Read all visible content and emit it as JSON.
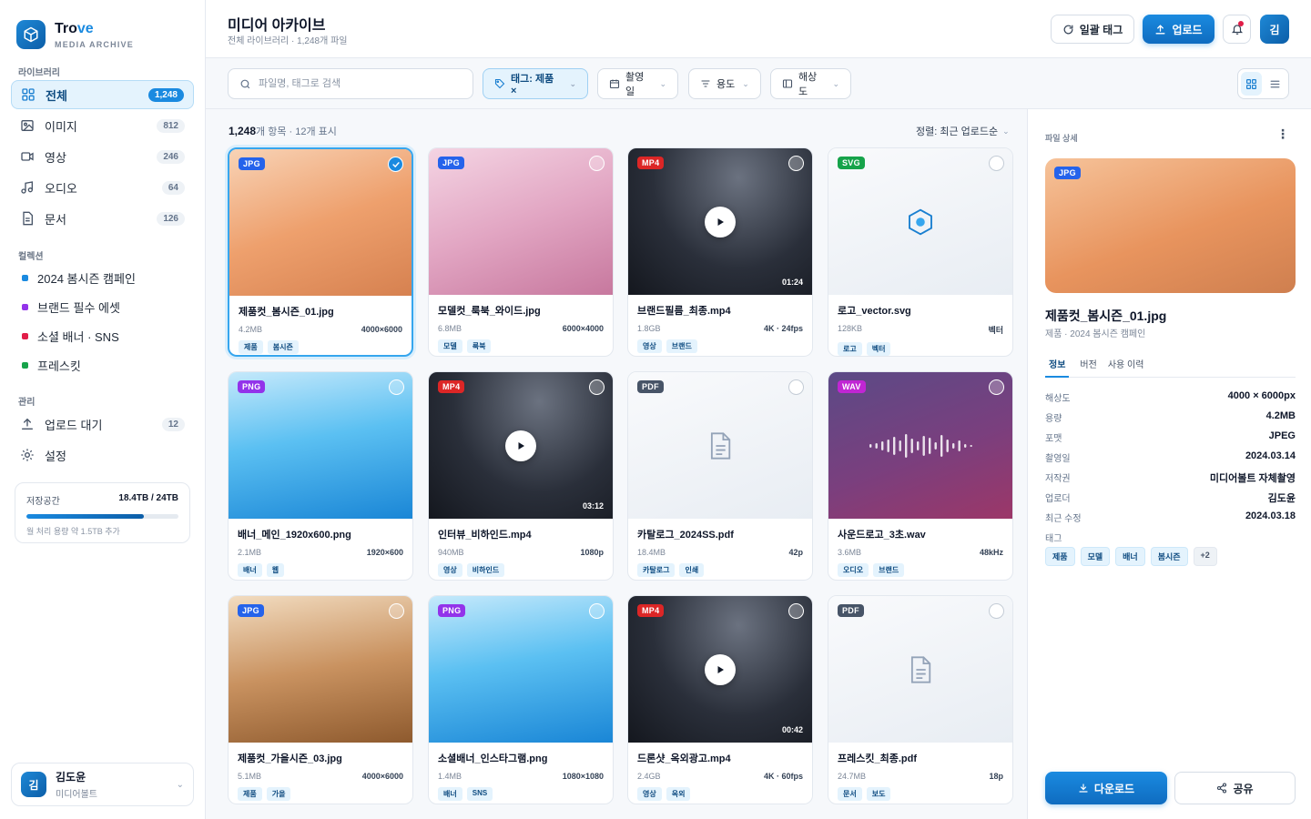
{
  "brand": {
    "name_main": "Tro",
    "name_accent": "ve",
    "subtitle": "MEDIA ARCHIVE"
  },
  "sidebar": {
    "library_label": "라이브러리",
    "library": [
      {
        "label": "전체",
        "count": "1,248",
        "icon": "grid-icon",
        "active": true
      },
      {
        "label": "이미지",
        "count": "812",
        "icon": "image-icon"
      },
      {
        "label": "영상",
        "count": "246",
        "icon": "video-icon"
      },
      {
        "label": "오디오",
        "count": "64",
        "icon": "music-icon"
      },
      {
        "label": "문서",
        "count": "126",
        "icon": "document-icon"
      }
    ],
    "collections_label": "컬렉션",
    "collections": [
      {
        "label": "2024 봄시즌 캠페인",
        "color": "#1a8ae0"
      },
      {
        "label": "브랜드 필수 에셋",
        "color": "#9333ea"
      },
      {
        "label": "소셜 배너 · SNS",
        "color": "#e11d48"
      },
      {
        "label": "프레스킷",
        "color": "#16a34a"
      }
    ],
    "manage_label": "관리",
    "manage": [
      {
        "label": "업로드 대기",
        "count": "12",
        "icon": "upload-icon"
      },
      {
        "label": "설정",
        "icon": "settings-icon"
      }
    ],
    "storage": {
      "label": "저장공간",
      "value": "18.4TB / 24TB",
      "fraction": 0.77,
      "note": "월 처리 용량 약 1.5TB 추가"
    },
    "user": {
      "initial": "김",
      "name": "김도윤",
      "org": "미디어볼트"
    }
  },
  "header": {
    "title": "미디어 아카이브",
    "subtitle": "전체 라이브러리 · 1,248개 파일",
    "bulk_tag": "일괄 태그",
    "upload": "업로드",
    "avatar": "김"
  },
  "toolbar": {
    "search_placeholder": "파일명, 태그로 검색",
    "filters": [
      {
        "label": "태그: 제품 ×",
        "active": true,
        "icon": "tag-icon"
      },
      {
        "label": "촬영일",
        "icon": "calendar-icon"
      },
      {
        "label": "용도",
        "icon": "filter-icon"
      },
      {
        "label": "해상도",
        "icon": "resolution-icon"
      }
    ]
  },
  "listing": {
    "count": "1,248",
    "count_suffix": "개 항목 · 12개 표시",
    "sort": "정렬: 최근 업로드순"
  },
  "files": [
    {
      "type": "JPG",
      "name": "제품컷_봄시즌_01.jpg",
      "size": "4.2MB",
      "dim": "4000×6000",
      "tags": [
        "제품",
        "봄시즌"
      ],
      "kind": "image",
      "bg": "linear-gradient(160deg,#f8d3b6 0%,#eea06d 50%,#d68150 100%)",
      "selected": true
    },
    {
      "type": "JPG",
      "name": "모델컷_룩북_와이드.jpg",
      "size": "6.8MB",
      "dim": "6000×4000",
      "tags": [
        "모델",
        "룩북"
      ],
      "kind": "image",
      "bg": "linear-gradient(160deg,#f4d4e3 0%,#e2a6c3 50%,#c7789e 100%)"
    },
    {
      "type": "MP4",
      "name": "브랜드필름_최종.mp4",
      "size": "1.8GB",
      "dim": "4K · 24fps",
      "tags": [
        "영상",
        "브랜드"
      ],
      "kind": "video",
      "duration": "01:24",
      "bg": "radial-gradient(ellipse at 60% 20%,#6b7280 0%,#2a2f3a 55%,#14171e 100%)"
    },
    {
      "type": "SVG",
      "name": "로고_vector.svg",
      "size": "128KB",
      "dim": "벡터",
      "tags": [
        "로고",
        "벡터"
      ],
      "kind": "vector",
      "bg": "linear-gradient(160deg,#f9fafc,#e8edf3)"
    },
    {
      "type": "PNG",
      "name": "배너_메인_1920x600.png",
      "size": "2.1MB",
      "dim": "1920×600",
      "tags": [
        "배너",
        "웹"
      ],
      "kind": "image",
      "bg": "linear-gradient(170deg,#c5e9fb 0%,#5bc0f2 45%,#1a86d6 100%)"
    },
    {
      "type": "MP4",
      "name": "인터뷰_비하인드.mp4",
      "size": "940MB",
      "dim": "1080p",
      "tags": [
        "영상",
        "비하인드"
      ],
      "kind": "video",
      "duration": "03:12",
      "bg": "radial-gradient(ellipse at 60% 20%,#6b7280 0%,#2a2f3a 55%,#14171e 100%)"
    },
    {
      "type": "PDF",
      "name": "카탈로그_2024SS.pdf",
      "size": "18.4MB",
      "dim": "42p",
      "tags": [
        "카탈로그",
        "인쇄"
      ],
      "kind": "document",
      "bg": "linear-gradient(160deg,#f9fafc,#e8edf3)"
    },
    {
      "type": "WAV",
      "name": "사운드로고_3초.wav",
      "size": "3.6MB",
      "dim": "48kHz",
      "tags": [
        "오디오",
        "브랜드"
      ],
      "kind": "audio",
      "bg": "linear-gradient(160deg,#5b4a86 0%,#7a3f7e 55%,#9c3768 100%)"
    },
    {
      "type": "JPG",
      "name": "제품컷_가을시즌_03.jpg",
      "size": "5.1MB",
      "dim": "4000×6000",
      "tags": [
        "제품",
        "가을"
      ],
      "kind": "image",
      "bg": "linear-gradient(170deg,#f2dcc0 0%,#c99260 50%,#8e5a2e 100%)"
    },
    {
      "type": "PNG",
      "name": "소셜배너_인스타그램.png",
      "size": "1.4MB",
      "dim": "1080×1080",
      "tags": [
        "배너",
        "SNS"
      ],
      "kind": "image",
      "bg": "linear-gradient(170deg,#c5e9fb 0%,#5bc0f2 45%,#1a86d6 100%)"
    },
    {
      "type": "MP4",
      "name": "드론샷_옥외광고.mp4",
      "size": "2.4GB",
      "dim": "4K · 60fps",
      "tags": [
        "영상",
        "옥외"
      ],
      "kind": "video",
      "duration": "00:42",
      "bg": "radial-gradient(ellipse at 60% 20%,#6b7280 0%,#2a2f3a 55%,#14171e 100%)"
    },
    {
      "type": "PDF",
      "name": "프레스킷_최종.pdf",
      "size": "24.7MB",
      "dim": "18p",
      "tags": [
        "문서",
        "보도"
      ],
      "kind": "document",
      "bg": "linear-gradient(160deg,#f9fafc,#e8edf3)"
    }
  ],
  "badge_colors": {
    "JPG": "#2563eb",
    "PNG": "#9333ea",
    "MP4": "#dc2626",
    "SVG": "#16a34a",
    "PDF": "#475467",
    "WAV": "#c026d3"
  },
  "detail": {
    "section_label": "파일 상세",
    "preview_badge": "JPG",
    "name": "제품컷_봄시즌_01.jpg",
    "sub": "제품 · 2024 봄시즌 캠페인",
    "tabs": [
      "정보",
      "버전",
      "사용 이력"
    ],
    "props": [
      {
        "k": "해상도",
        "v": "4000 × 6000px"
      },
      {
        "k": "용량",
        "v": "4.2MB"
      },
      {
        "k": "포맷",
        "v": "JPEG"
      },
      {
        "k": "촬영일",
        "v": "2024.03.14"
      },
      {
        "k": "저작권",
        "v": "미디어볼트 자체촬영"
      },
      {
        "k": "업로더",
        "v": "김도윤"
      },
      {
        "k": "최근 수정",
        "v": "2024.03.18"
      },
      {
        "k": "태그",
        "v": ""
      }
    ],
    "tags": [
      "제품",
      "모델",
      "배너",
      "봄시즌"
    ],
    "more_tags": "+2",
    "download": "다운로드",
    "share": "공유"
  }
}
